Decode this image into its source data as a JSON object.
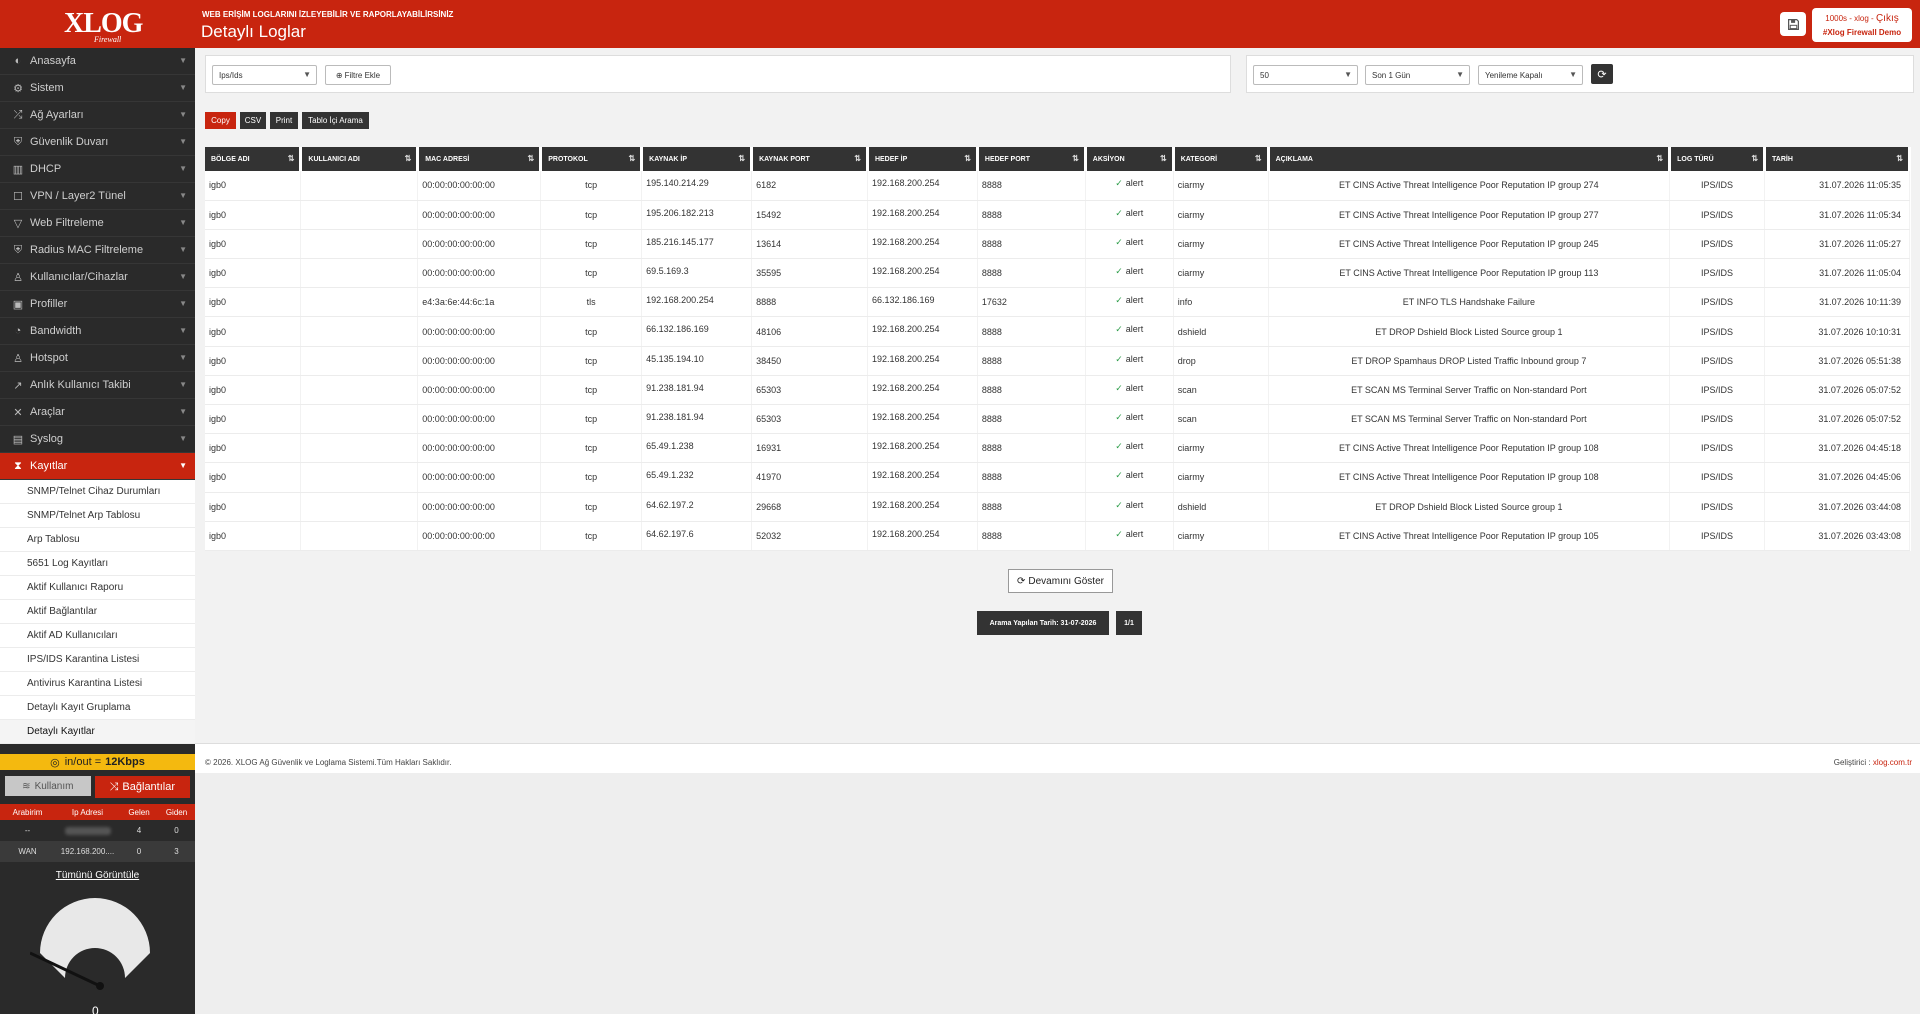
{
  "header": {
    "logo_text": "XLOG",
    "logo_sub": "Firewall",
    "subtitle": "WEB ERİŞİM LOGLARINI İZLEYEBİLİR VE RAPORLAYABİLİRSİNİZ",
    "title": "Detaylı Loglar",
    "user_line": "1000s - xlog -",
    "logout": "Çıkış",
    "demo": "#Xlog Firewall Demo"
  },
  "sidebar": {
    "items": [
      {
        "label": "Anasayfa",
        "icon": "◐"
      },
      {
        "label": "Sistem",
        "icon": "⚙"
      },
      {
        "label": "Ağ Ayarları",
        "icon": "⤮"
      },
      {
        "label": "Güvenlik Duvarı",
        "icon": "⛨"
      },
      {
        "label": "DHCP",
        "icon": "▥"
      },
      {
        "label": "VPN / Layer2 Tünel",
        "icon": "☐"
      },
      {
        "label": "Web Filtreleme",
        "icon": "▽"
      },
      {
        "label": "Radius MAC Filtreleme",
        "icon": "⛨"
      },
      {
        "label": "Kullanıcılar/Cihazlar",
        "icon": "♙"
      },
      {
        "label": "Profiller",
        "icon": "▣"
      },
      {
        "label": "Bandwidth",
        "icon": "◔"
      },
      {
        "label": "Hotspot",
        "icon": "♙"
      },
      {
        "label": "Anlık Kullanıcı Takibi",
        "icon": "↗"
      },
      {
        "label": "Araçlar",
        "icon": "✕"
      },
      {
        "label": "Syslog",
        "icon": "▤"
      },
      {
        "label": "Kayıtlar",
        "icon": "⧗"
      }
    ],
    "subitems": [
      "SNMP/Telnet Cihaz Durumları",
      "SNMP/Telnet Arp Tablosu",
      "Arp Tablosu",
      "5651 Log Kayıtları",
      "Aktif Kullanıcı Raporu",
      "Aktif Bağlantılar",
      "Aktif AD Kullanıcıları",
      "IPS/IDS Karantina Listesi",
      "Antivirus Karantina Listesi",
      "Detaylı Kayıt Gruplama",
      "Detaylı Kayıtlar"
    ],
    "traffic_label": "in/out =",
    "traffic_value": "12Kbps",
    "tab_usage": "Kullanım",
    "tab_connections": "Bağlantılar",
    "if_headers": [
      "Arabirim",
      "Ip Adresi",
      "Gelen",
      "Giden"
    ],
    "if_rows": [
      {
        "name": "--",
        "ip": "",
        "in": "4",
        "out": "0"
      },
      {
        "name": "WAN",
        "ip": "192.168.200....",
        "in": "0",
        "out": "3"
      }
    ],
    "view_all": "Tümünü Görüntüle",
    "gauge_value": "0"
  },
  "filters": {
    "type_select": "Ips/Ids",
    "add_filter": "Filtre Ekle",
    "limit_select": "50",
    "range_select": "Son 1 Gün",
    "refresh_select": "Yenileme Kapalı"
  },
  "tools": [
    "Copy",
    "CSV",
    "Print",
    "Tablo İçi Arama"
  ],
  "table": {
    "headers": [
      "BÖLGE ADI",
      "KULLANICI ADI",
      "MAC ADRESİ",
      "PROTOKOL",
      "KAYNAK İP",
      "KAYNAK PORT",
      "HEDEF İP",
      "HEDEF PORT",
      "AKSİYON",
      "KATEGORİ",
      "AÇIKLAMA",
      "LOG TÜRÜ",
      "TARİH"
    ],
    "rows": [
      [
        "igb0",
        "",
        "00:00:00:00:00:00",
        "tcp",
        "195.140.214.29",
        "6182",
        "192.168.200.254",
        "8888",
        "alert",
        "ciarmy",
        "ET CINS Active Threat Intelligence Poor Reputation IP group 274",
        "IPS/IDS",
        "31.07.2026 11:05:35"
      ],
      [
        "igb0",
        "",
        "00:00:00:00:00:00",
        "tcp",
        "195.206.182.213",
        "15492",
        "192.168.200.254",
        "8888",
        "alert",
        "ciarmy",
        "ET CINS Active Threat Intelligence Poor Reputation IP group 277",
        "IPS/IDS",
        "31.07.2026 11:05:34"
      ],
      [
        "igb0",
        "",
        "00:00:00:00:00:00",
        "tcp",
        "185.216.145.177",
        "13614",
        "192.168.200.254",
        "8888",
        "alert",
        "ciarmy",
        "ET CINS Active Threat Intelligence Poor Reputation IP group 245",
        "IPS/IDS",
        "31.07.2026 11:05:27"
      ],
      [
        "igb0",
        "",
        "00:00:00:00:00:00",
        "tcp",
        "69.5.169.3",
        "35595",
        "192.168.200.254",
        "8888",
        "alert",
        "ciarmy",
        "ET CINS Active Threat Intelligence Poor Reputation IP group 113",
        "IPS/IDS",
        "31.07.2026 11:05:04"
      ],
      [
        "igb0",
        "",
        "e4:3a:6e:44:6c:1a",
        "tls",
        "192.168.200.254",
        "8888",
        "66.132.186.169",
        "17632",
        "alert",
        "info",
        "ET INFO TLS Handshake Failure",
        "IPS/IDS",
        "31.07.2026 10:11:39"
      ],
      [
        "igb0",
        "",
        "00:00:00:00:00:00",
        "tcp",
        "66.132.186.169",
        "48106",
        "192.168.200.254",
        "8888",
        "alert",
        "dshield",
        "ET DROP Dshield Block Listed Source group 1",
        "IPS/IDS",
        "31.07.2026 10:10:31"
      ],
      [
        "igb0",
        "",
        "00:00:00:00:00:00",
        "tcp",
        "45.135.194.10",
        "38450",
        "192.168.200.254",
        "8888",
        "alert",
        "drop",
        "ET DROP Spamhaus DROP Listed Traffic Inbound group 7",
        "IPS/IDS",
        "31.07.2026 05:51:38"
      ],
      [
        "igb0",
        "",
        "00:00:00:00:00:00",
        "tcp",
        "91.238.181.94",
        "65303",
        "192.168.200.254",
        "8888",
        "alert",
        "scan",
        "ET SCAN MS Terminal Server Traffic on Non-standard Port",
        "IPS/IDS",
        "31.07.2026 05:07:52"
      ],
      [
        "igb0",
        "",
        "00:00:00:00:00:00",
        "tcp",
        "91.238.181.94",
        "65303",
        "192.168.200.254",
        "8888",
        "alert",
        "scan",
        "ET SCAN MS Terminal Server Traffic on Non-standard Port",
        "IPS/IDS",
        "31.07.2026 05:07:52"
      ],
      [
        "igb0",
        "",
        "00:00:00:00:00:00",
        "tcp",
        "65.49.1.238",
        "16931",
        "192.168.200.254",
        "8888",
        "alert",
        "ciarmy",
        "ET CINS Active Threat Intelligence Poor Reputation IP group 108",
        "IPS/IDS",
        "31.07.2026 04:45:18"
      ],
      [
        "igb0",
        "",
        "00:00:00:00:00:00",
        "tcp",
        "65.49.1.232",
        "41970",
        "192.168.200.254",
        "8888",
        "alert",
        "ciarmy",
        "ET CINS Active Threat Intelligence Poor Reputation IP group 108",
        "IPS/IDS",
        "31.07.2026 04:45:06"
      ],
      [
        "igb0",
        "",
        "00:00:00:00:00:00",
        "tcp",
        "64.62.197.2",
        "29668",
        "192.168.200.254",
        "8888",
        "alert",
        "dshield",
        "ET DROP Dshield Block Listed Source group 1",
        "IPS/IDS",
        "31.07.2026 03:44:08"
      ],
      [
        "igb0",
        "",
        "00:00:00:00:00:00",
        "tcp",
        "64.62.197.6",
        "52032",
        "192.168.200.254",
        "8888",
        "alert",
        "ciarmy",
        "ET CINS Active Threat Intelligence Poor Reputation IP group 105",
        "IPS/IDS",
        "31.07.2026 03:43:08"
      ]
    ]
  },
  "pager": {
    "more": "Devamını Göster",
    "search_date": "Arama Yapılan Tarih: 31-07-2026",
    "page": "1/1"
  },
  "footer": {
    "copyright": "© 2026. XLOG Ağ Güvenlik ve Loglama Sistemi.Tüm Hakları Saklıdır.",
    "dev_label": "Geliştirici :",
    "dev_link": "xlog.com.tr"
  },
  "colors": {
    "brand": "#c8250f",
    "dark": "#2a2a2a",
    "traffic": "#f4b90f"
  }
}
